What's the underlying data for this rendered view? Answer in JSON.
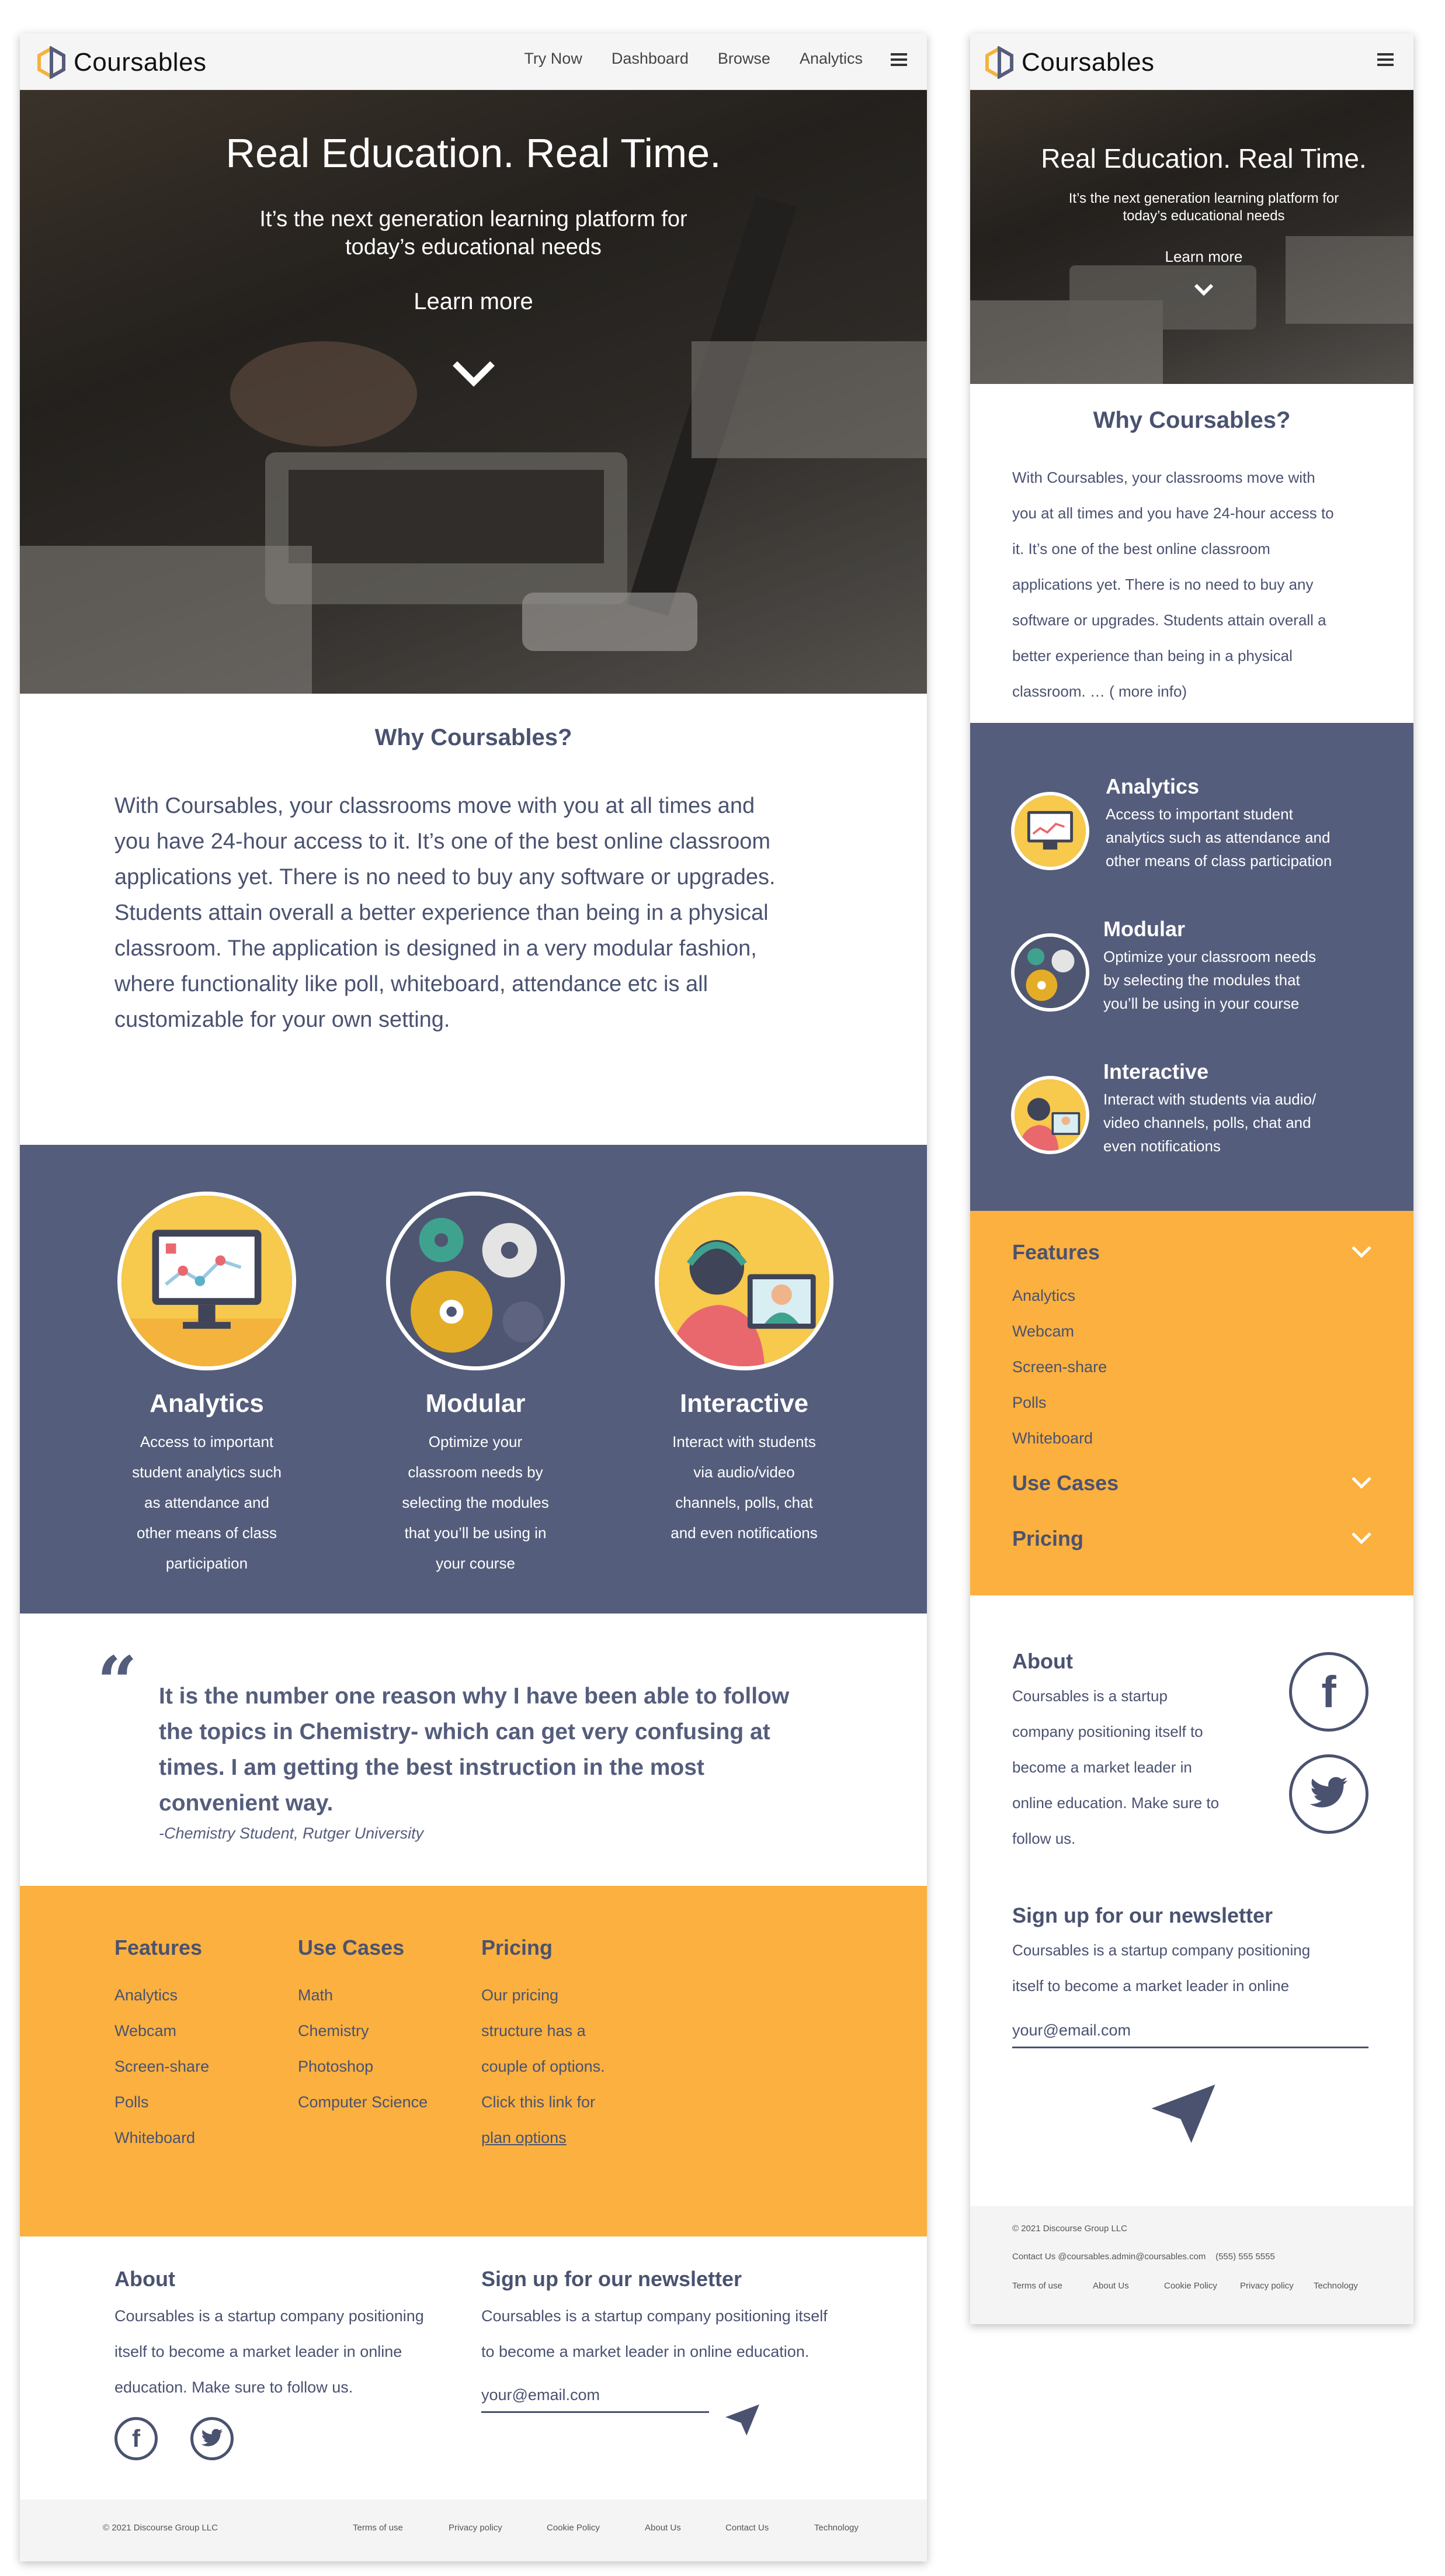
{
  "brand": {
    "name": "Coursables"
  },
  "nav": {
    "links": [
      "Try Now",
      "Dashboard",
      "Browse",
      "Analytics"
    ]
  },
  "hero": {
    "title": "Real Education. Real Time.",
    "subtitle_line1": "It’s the next generation learning platform for",
    "subtitle_line2": "today’s educational needs",
    "cta": "Learn more"
  },
  "why": {
    "title": "Why Coursables?",
    "desktop_lines": [
      "With Coursables, your classrooms move with you at all times and",
      "you have 24-hour access to it. It’s one of the best online classroom",
      "applications yet. There is no need to buy any software or upgrades.",
      "Students attain overall a better experience than being in a physical",
      "classroom. The application is designed in a very modular fashion,",
      "where functionality like poll, whiteboard, attendance etc is all",
      "customizable for your own setting."
    ],
    "mobile_lines": [
      "With Coursables, your classrooms move with",
      "you at all times and you have 24-hour access to",
      "it. It’s one of the best online classroom",
      "applications yet. There is no need to buy any",
      "software or upgrades.  Students attain overall a",
      "better experience than being in a physical",
      "classroom. … ( more info)"
    ]
  },
  "features": [
    {
      "title": "Analytics",
      "icon": "analytics-icon",
      "desktop_lines": [
        "Access to important",
        "student analytics such",
        "as attendance and",
        "other means of class",
        "participation"
      ],
      "mobile_lines": [
        "Access to important student",
        "analytics such as attendance and",
        "other means of class participation"
      ]
    },
    {
      "title": "Modular",
      "icon": "gears-icon",
      "desktop_lines": [
        "Optimize your",
        "classroom needs by",
        "selecting the modules",
        "that you’ll be using in",
        "your course"
      ],
      "mobile_lines": [
        "Optimize your classroom needs",
        "by selecting the modules that",
        "you’ll be using in your course"
      ]
    },
    {
      "title": "Interactive",
      "icon": "video-call-icon",
      "desktop_lines": [
        "Interact with students",
        "via audio/video",
        "channels, polls, chat",
        "and even notifications"
      ],
      "mobile_lines": [
        "Interact with students via audio/",
        "video channels, polls, chat and",
        "even notifications"
      ]
    }
  ],
  "testimonial": {
    "quote_lines": [
      "It is the number one reason why I have been able to follow",
      "the topics in Chemistry- which can get very confusing at",
      "times. I am getting the best instruction in the most",
      "convenient way."
    ],
    "author": "-Chemistry Student, Rutger University"
  },
  "footer_columns": {
    "features": {
      "title": "Features",
      "items": [
        "Analytics",
        "Webcam",
        "Screen-share",
        "Polls",
        "Whiteboard"
      ]
    },
    "use_cases": {
      "title": "Use Cases",
      "items": [
        "Math",
        "Chemistry",
        "Photoshop",
        "Computer Science"
      ]
    },
    "pricing": {
      "title": "Pricing",
      "lines": [
        "Our pricing",
        "structure has a",
        "couple of options.",
        "Click this link for"
      ],
      "link": "plan options"
    }
  },
  "about": {
    "title": "About",
    "desktop_lines": [
      "Coursables is a startup company positioning",
      "itself to become a market leader in online",
      "education. Make sure to follow us."
    ],
    "mobile_lines": [
      "Coursables is a startup",
      "company positioning itself to",
      "become a market leader in",
      "online education. Make sure to",
      "follow us."
    ]
  },
  "newsletter": {
    "title": "Sign up for our newsletter",
    "desktop_lines": [
      "Coursables is a startup company positioning itself",
      "to become a market leader in online education."
    ],
    "mobile_lines": [
      "Coursables is a startup company positioning",
      "itself to become a market leader in online"
    ],
    "placeholder": "your@email.com"
  },
  "footer": {
    "copyright": "© 2021 Discourse Group LLC",
    "desktop_links": [
      "Terms of use",
      "Privacy policy",
      "Cookie Policy",
      "About Us",
      "Contact Us",
      "Technology"
    ],
    "mobile_contact": "Contact Us @coursables.admin@coursables.com    (555) 555 5555",
    "mobile_links": [
      "Terms of use",
      "About Us",
      "Cookie Policy",
      "Privacy policy",
      "Technology"
    ]
  },
  "colors": {
    "navy": "#555d7c",
    "text": "#4a5270",
    "orange": "#fbb03f",
    "footer_gray": "#f4f4f4"
  }
}
